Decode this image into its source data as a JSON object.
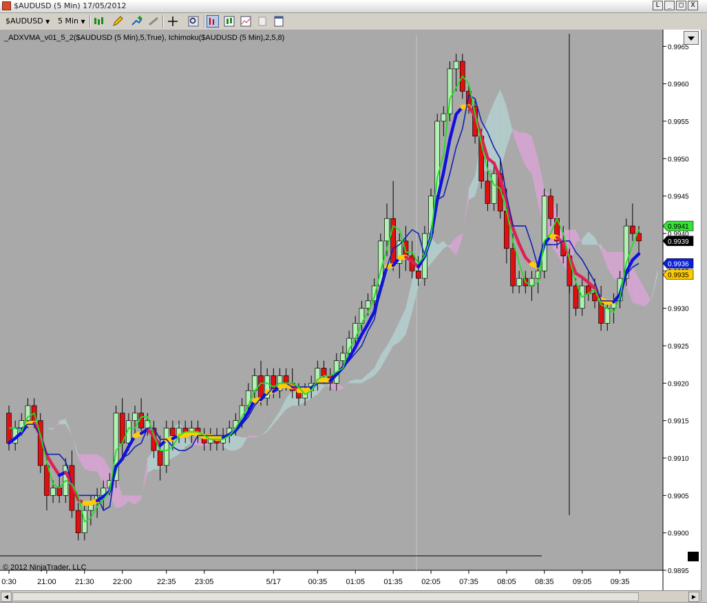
{
  "window": {
    "title": "$AUDUSD (5 Min)  17/05/2012",
    "buttons": [
      "L",
      "_",
      "□",
      "X"
    ]
  },
  "toolbar": {
    "instrument": "$AUDUSD",
    "interval": "5 Min"
  },
  "indicator_label": "_ADXVMA_v01_5_2($AUDUSD (5 Min),5,True),  Ichimoku($AUDUSD (5 Min),2,5,8)",
  "copyright": "© 2012 NinjaTrader, LLC",
  "price_tags": [
    {
      "label": "0.9941",
      "value": 0.9941,
      "bg": "#33e633",
      "fg": "#000000"
    },
    {
      "label": "0.9939",
      "value": 0.9939,
      "bg": "#000000",
      "fg": "#ffffff"
    },
    {
      "label": "0.9936",
      "value": 0.9936,
      "bg": "#0a1fd6",
      "fg": "#ffffff"
    },
    {
      "label": "0.9935",
      "value": 0.99345,
      "bg": "#ffcc00",
      "fg": "#000000"
    }
  ],
  "colors": {
    "background": "#a9a9a9",
    "bull_candle": "#b3f0b3",
    "bear_candle": "#e01010",
    "adxvma_up": "#1010e0",
    "adxvma_down": "#dd2255",
    "adxvma_flat": "#ffcc00",
    "tenkan": "#22dd22",
    "kijun": "#1020b0",
    "cloud_bull": "#b4d0d0",
    "cloud_bear": "#d8a4d4"
  },
  "chart_data": {
    "type": "candlestick",
    "ylim": [
      0.9895,
      0.99665
    ],
    "y_ticks": [
      0.9895,
      0.99,
      0.9905,
      0.991,
      0.9915,
      0.992,
      0.9925,
      0.993,
      0.9935,
      0.994,
      0.9945,
      0.995,
      0.9955,
      0.996,
      0.9965
    ],
    "y_tick_labels": [
      "0.9895",
      "0.9900",
      "0.9905",
      "0.9910",
      "0.9915",
      "0.9920",
      "0.9925",
      "0.9930",
      "0.9935",
      "0.9940",
      "0.9945",
      "0.9950",
      "0.9955",
      "0.9960",
      "0.9965"
    ],
    "x_labels": [
      {
        "label": "0:30",
        "bar": 0
      },
      {
        "label": "21:00",
        "bar": 6
      },
      {
        "label": "21:30",
        "bar": 12
      },
      {
        "label": "22:00",
        "bar": 18
      },
      {
        "label": "22:35",
        "bar": 25
      },
      {
        "label": "23:05",
        "bar": 31
      },
      {
        "label": "5/17",
        "bar": 42
      },
      {
        "label": "00:35",
        "bar": 49
      },
      {
        "label": "01:05",
        "bar": 55
      },
      {
        "label": "01:35",
        "bar": 61
      },
      {
        "label": "02:05",
        "bar": 67
      },
      {
        "label": "07:35",
        "bar": 73
      },
      {
        "label": "08:05",
        "bar": 79
      },
      {
        "label": "08:35",
        "bar": 85
      },
      {
        "label": "09:05",
        "bar": 91
      },
      {
        "label": "09:35",
        "bar": 97
      }
    ],
    "ohlc": [
      [
        0.9916,
        0.9917,
        0.9911,
        0.9912
      ],
      [
        0.9912,
        0.9915,
        0.9911,
        0.9914
      ],
      [
        0.9914,
        0.9916,
        0.9913,
        0.9915
      ],
      [
        0.9915,
        0.9918,
        0.9914,
        0.9917
      ],
      [
        0.9917,
        0.9918,
        0.9914,
        0.9915
      ],
      [
        0.9915,
        0.9916,
        0.9908,
        0.9909
      ],
      [
        0.9909,
        0.991,
        0.9903,
        0.9905
      ],
      [
        0.9905,
        0.9907,
        0.9904,
        0.9906
      ],
      [
        0.9906,
        0.9908,
        0.9904,
        0.9905
      ],
      [
        0.9905,
        0.991,
        0.9904,
        0.9909
      ],
      [
        0.9909,
        0.9911,
        0.9902,
        0.9903
      ],
      [
        0.9903,
        0.9904,
        0.9899,
        0.99
      ],
      [
        0.99,
        0.9904,
        0.9899,
        0.9903
      ],
      [
        0.9903,
        0.9905,
        0.9901,
        0.9904
      ],
      [
        0.9904,
        0.9906,
        0.9902,
        0.9905
      ],
      [
        0.9905,
        0.9907,
        0.9903,
        0.9906
      ],
      [
        0.9906,
        0.9908,
        0.9905,
        0.9907
      ],
      [
        0.9907,
        0.9917,
        0.9906,
        0.9916
      ],
      [
        0.9916,
        0.9918,
        0.991,
        0.9912
      ],
      [
        0.9912,
        0.9916,
        0.9911,
        0.9915
      ],
      [
        0.9915,
        0.9917,
        0.9913,
        0.9916
      ],
      [
        0.9916,
        0.9918,
        0.9913,
        0.9914
      ],
      [
        0.9914,
        0.9916,
        0.9913,
        0.9915
      ],
      [
        0.9914,
        0.9915,
        0.991,
        0.9911
      ],
      [
        0.9911,
        0.9913,
        0.9907,
        0.9909
      ],
      [
        0.9909,
        0.9915,
        0.9908,
        0.9914
      ],
      [
        0.9914,
        0.9915,
        0.9911,
        0.9913
      ],
      [
        0.9913,
        0.9915,
        0.9912,
        0.9914
      ],
      [
        0.9914,
        0.9915,
        0.9912,
        0.9913
      ],
      [
        0.9913,
        0.9915,
        0.9912,
        0.9914
      ],
      [
        0.9914,
        0.9915,
        0.9912,
        0.9913
      ],
      [
        0.9913,
        0.9914,
        0.9911,
        0.9912
      ],
      [
        0.9912,
        0.9914,
        0.9911,
        0.9913
      ],
      [
        0.9913,
        0.9914,
        0.9911,
        0.9912
      ],
      [
        0.9912,
        0.9914,
        0.9911,
        0.9913
      ],
      [
        0.9913,
        0.9915,
        0.9912,
        0.9914
      ],
      [
        0.9914,
        0.9916,
        0.9913,
        0.9915
      ],
      [
        0.9915,
        0.9918,
        0.9914,
        0.9917
      ],
      [
        0.9917,
        0.992,
        0.9916,
        0.9919
      ],
      [
        0.9919,
        0.9922,
        0.9918,
        0.9921
      ],
      [
        0.9921,
        0.9923,
        0.9917,
        0.9918
      ],
      [
        0.9918,
        0.9922,
        0.9917,
        0.9921
      ],
      [
        0.9921,
        0.9922,
        0.9918,
        0.9919
      ],
      [
        0.9919,
        0.9922,
        0.9918,
        0.9921
      ],
      [
        0.9921,
        0.9922,
        0.9919,
        0.992
      ],
      [
        0.992,
        0.9922,
        0.9918,
        0.9919
      ],
      [
        0.9919,
        0.992,
        0.9917,
        0.9918
      ],
      [
        0.9918,
        0.992,
        0.9917,
        0.9919
      ],
      [
        0.9919,
        0.9921,
        0.9918,
        0.992
      ],
      [
        0.992,
        0.9923,
        0.9919,
        0.9922
      ],
      [
        0.9922,
        0.9923,
        0.992,
        0.9921
      ],
      [
        0.9921,
        0.9922,
        0.9919,
        0.992
      ],
      [
        0.992,
        0.9924,
        0.9919,
        0.9923
      ],
      [
        0.9923,
        0.9925,
        0.9922,
        0.9924
      ],
      [
        0.9924,
        0.9927,
        0.9923,
        0.9926
      ],
      [
        0.9926,
        0.9929,
        0.9925,
        0.9928
      ],
      [
        0.9928,
        0.9931,
        0.9927,
        0.993
      ],
      [
        0.993,
        0.9932,
        0.9929,
        0.9931
      ],
      [
        0.9931,
        0.9934,
        0.993,
        0.9933
      ],
      [
        0.9933,
        0.994,
        0.9932,
        0.9939
      ],
      [
        0.9939,
        0.9944,
        0.9937,
        0.9942
      ],
      [
        0.9942,
        0.9947,
        0.9935,
        0.9936
      ],
      [
        0.9936,
        0.994,
        0.9934,
        0.9939
      ],
      [
        0.9939,
        0.9941,
        0.9935,
        0.9937
      ],
      [
        0.9937,
        0.9939,
        0.9934,
        0.9935
      ],
      [
        0.9935,
        0.9937,
        0.9933,
        0.9934
      ],
      [
        0.9934,
        0.9941,
        0.9933,
        0.994
      ],
      [
        0.994,
        0.9946,
        0.9939,
        0.9945
      ],
      [
        0.9945,
        0.9956,
        0.9944,
        0.9955
      ],
      [
        0.9955,
        0.9957,
        0.9953,
        0.9956
      ],
      [
        0.9956,
        0.9963,
        0.9955,
        0.9962
      ],
      [
        0.9962,
        0.9964,
        0.9959,
        0.9963
      ],
      [
        0.9963,
        0.9964,
        0.9958,
        0.9959
      ],
      [
        0.9959,
        0.996,
        0.9956,
        0.9957
      ],
      [
        0.9957,
        0.9958,
        0.9952,
        0.9953
      ],
      [
        0.9953,
        0.9954,
        0.9946,
        0.9947
      ],
      [
        0.9947,
        0.995,
        0.9943,
        0.9944
      ],
      [
        0.9944,
        0.9949,
        0.9943,
        0.9948
      ],
      [
        0.9948,
        0.995,
        0.9942,
        0.9943
      ],
      [
        0.9943,
        0.9946,
        0.9936,
        0.9938
      ],
      [
        0.9938,
        0.994,
        0.9932,
        0.9933
      ],
      [
        0.9933,
        0.9935,
        0.9932,
        0.9934
      ],
      [
        0.9934,
        0.9935,
        0.9932,
        0.9933
      ],
      [
        0.9933,
        0.9935,
        0.9931,
        0.9934
      ],
      [
        0.9934,
        0.9936,
        0.9932,
        0.9935
      ],
      [
        0.9935,
        0.9946,
        0.9934,
        0.9945
      ],
      [
        0.9945,
        0.9946,
        0.9941,
        0.9942
      ],
      [
        0.9942,
        0.9944,
        0.9938,
        0.9939
      ],
      [
        0.9939,
        0.9941,
        0.9936,
        0.9937
      ],
      [
        0.9937,
        0.9938,
        0.9932,
        0.9933
      ],
      [
        0.9933,
        0.9934,
        0.9929,
        0.993
      ],
      [
        0.993,
        0.9934,
        0.9929,
        0.9933
      ],
      [
        0.9933,
        0.9935,
        0.9931,
        0.9932
      ],
      [
        0.9932,
        0.9934,
        0.993,
        0.9931
      ],
      [
        0.9931,
        0.9933,
        0.9927,
        0.9928
      ],
      [
        0.9928,
        0.9931,
        0.9927,
        0.993
      ],
      [
        0.993,
        0.9932,
        0.9928,
        0.9931
      ],
      [
        0.9931,
        0.9935,
        0.993,
        0.9934
      ],
      [
        0.9934,
        0.9942,
        0.9933,
        0.9941
      ],
      [
        0.9941,
        0.9944,
        0.9939,
        0.994
      ],
      [
        0.994,
        0.9941,
        0.9937,
        0.9939
      ]
    ]
  }
}
